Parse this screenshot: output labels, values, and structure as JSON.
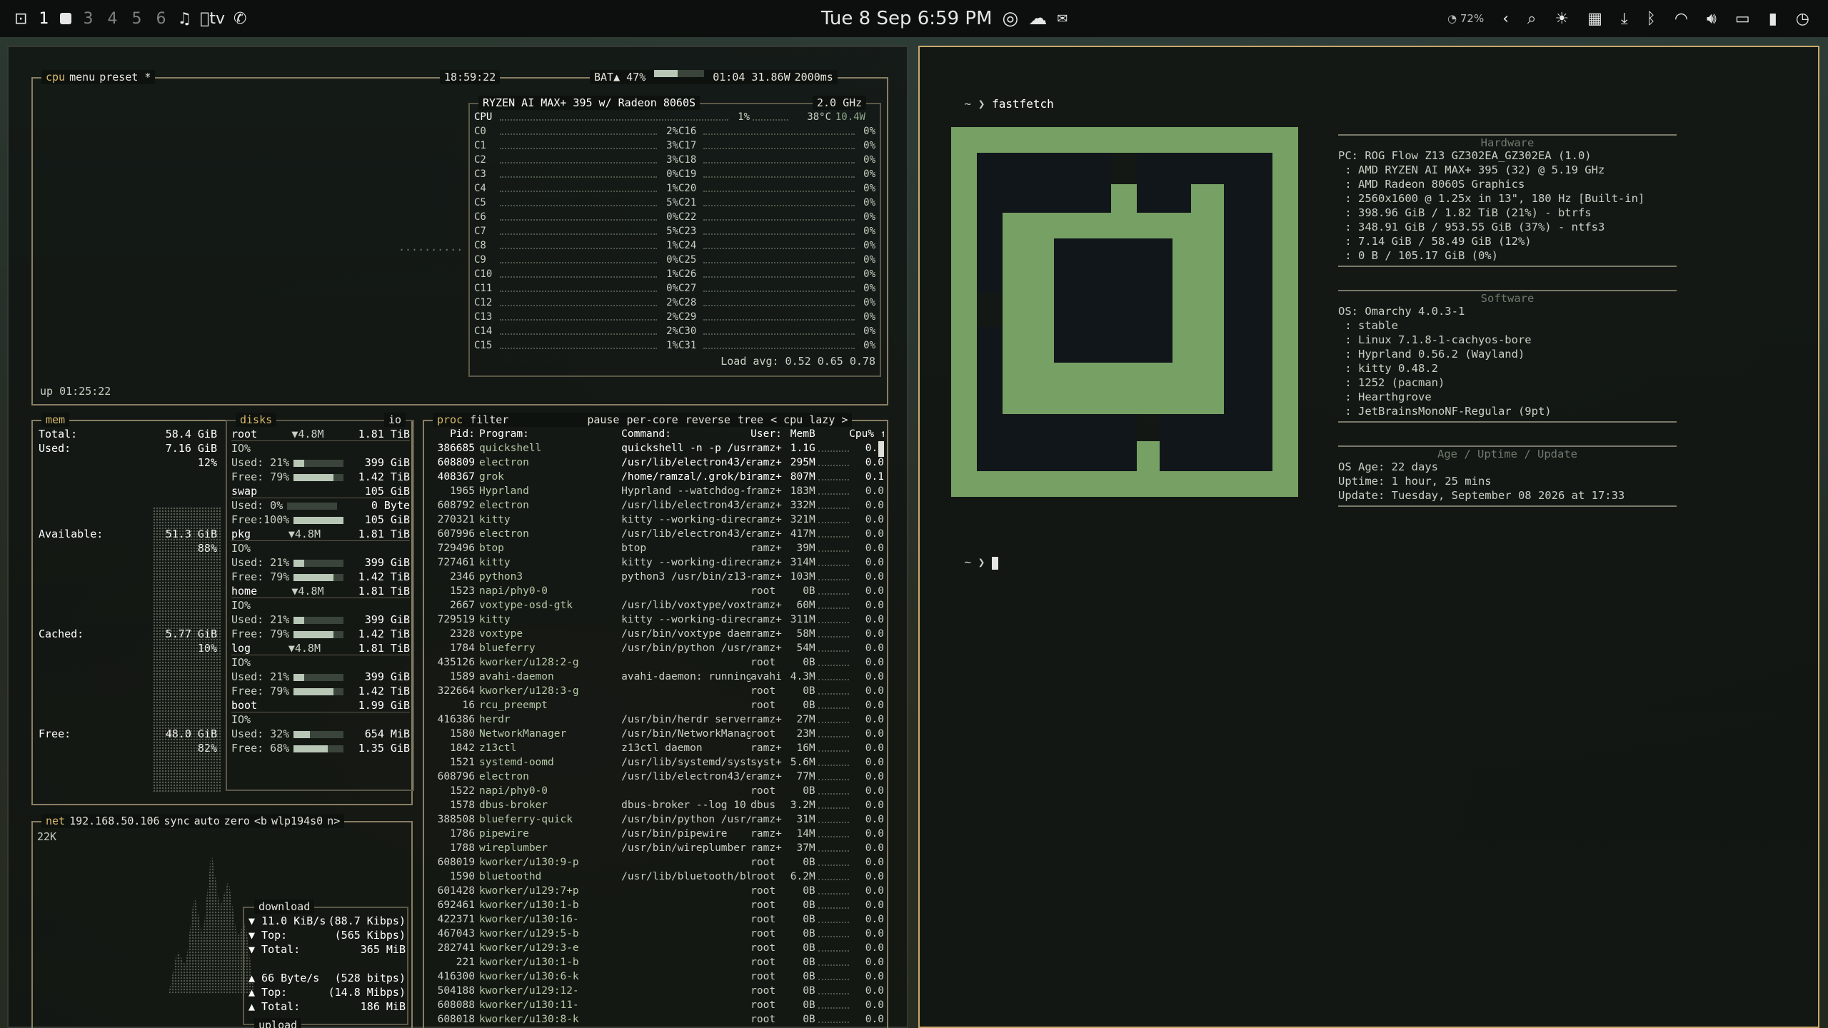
{
  "topbar": {
    "workspaces": [
      "1",
      "3",
      "4",
      "5",
      "6"
    ],
    "datetime": "Tue 8 Sep 6:59 PM",
    "battery_small": "72%",
    "apple_tv": "tv"
  },
  "btop": {
    "cpu_box": {
      "tabs": [
        "cpu",
        "menu",
        "preset *"
      ],
      "clock": "18:59:22",
      "battery": "BAT▲ 47%",
      "battery_level": 0.47,
      "power": "01:04 31.86W",
      "interval": "2000ms",
      "uptime": "up 01:25:22",
      "model": "RYZEN AI MAX+ 395 w/ Radeon 8060S",
      "freq": "2.0 GHz",
      "total": {
        "label": "CPU",
        "pct": "1%",
        "temp": "38°C",
        "watt": "10.4W"
      },
      "cores_left": [
        {
          "l": "C0",
          "p": "2%"
        },
        {
          "l": "C1",
          "p": "3%"
        },
        {
          "l": "C2",
          "p": "3%"
        },
        {
          "l": "C3",
          "p": "0%"
        },
        {
          "l": "C4",
          "p": "1%"
        },
        {
          "l": "C5",
          "p": "5%"
        },
        {
          "l": "C6",
          "p": "0%"
        },
        {
          "l": "C7",
          "p": "5%"
        },
        {
          "l": "C8",
          "p": "1%"
        },
        {
          "l": "C9",
          "p": "0%"
        },
        {
          "l": "C10",
          "p": "1%"
        },
        {
          "l": "C11",
          "p": "0%"
        },
        {
          "l": "C12",
          "p": "2%"
        },
        {
          "l": "C13",
          "p": "2%"
        },
        {
          "l": "C14",
          "p": "2%"
        },
        {
          "l": "C15",
          "p": "1%"
        }
      ],
      "cores_right": [
        {
          "l": "C16",
          "p": "0%"
        },
        {
          "l": "C17",
          "p": "0%"
        },
        {
          "l": "C18",
          "p": "0%"
        },
        {
          "l": "C19",
          "p": "0%"
        },
        {
          "l": "C20",
          "p": "0%"
        },
        {
          "l": "C21",
          "p": "0%"
        },
        {
          "l": "C22",
          "p": "0%"
        },
        {
          "l": "C23",
          "p": "0%"
        },
        {
          "l": "C24",
          "p": "0%"
        },
        {
          "l": "C25",
          "p": "0%"
        },
        {
          "l": "C26",
          "p": "0%"
        },
        {
          "l": "C27",
          "p": "0%"
        },
        {
          "l": "C28",
          "p": "0%"
        },
        {
          "l": "C29",
          "p": "0%"
        },
        {
          "l": "C30",
          "p": "0%"
        },
        {
          "l": "C31",
          "p": "0%"
        }
      ],
      "load_avg": "Load avg: 0.52 0.65 0.78"
    },
    "mem_box": {
      "title": "mem",
      "rows": [
        {
          "k": "Total:",
          "v": "58.4 GiB"
        },
        {
          "k": "Used:",
          "v": "7.16 GiB"
        },
        {
          "k": "",
          "v": "12%"
        },
        {
          "k": "Available:",
          "v": "51.3 GiB"
        },
        {
          "k": "",
          "v": "88%"
        },
        {
          "k": "Cached:",
          "v": "5.77 GiB"
        },
        {
          "k": "",
          "v": "10%"
        },
        {
          "k": "Free:",
          "v": "48.0 GiB"
        },
        {
          "k": "",
          "v": "82%"
        }
      ]
    },
    "disks_box": {
      "title": "disks",
      "io": "io",
      "disks": [
        {
          "name": "root",
          "io": "▼4.8M",
          "size": "1.81 TiB",
          "io_pct": "IO%",
          "used": "Used: 21%",
          "used_v": "399 GiB",
          "used_f": 0.21,
          "free": "Free: 79%",
          "free_v": "1.42 TiB",
          "free_f": 0.79
        },
        {
          "name": "swap",
          "io": "",
          "size": "105 GiB",
          "io_pct": "",
          "used": "Used:  0%",
          "used_v": "0 Byte",
          "used_f": 0,
          "free": "Free:100%",
          "free_v": "105 GiB",
          "free_f": 1.0
        },
        {
          "name": "pkg",
          "io": "▼4.8M",
          "size": "1.81 TiB",
          "io_pct": "IO%",
          "used": "Used: 21%",
          "used_v": "399 GiB",
          "used_f": 0.21,
          "free": "Free: 79%",
          "free_v": "1.42 TiB",
          "free_f": 0.79
        },
        {
          "name": "home",
          "io": "▼4.8M",
          "size": "1.81 TiB",
          "io_pct": "IO%",
          "used": "Used: 21%",
          "used_v": "399 GiB",
          "used_f": 0.21,
          "free": "Free: 79%",
          "free_v": "1.42 TiB",
          "free_f": 0.79
        },
        {
          "name": "log",
          "io": "▼4.8M",
          "size": "1.81 TiB",
          "io_pct": "IO%",
          "used": "Used: 21%",
          "used_v": "399 GiB",
          "used_f": 0.21,
          "free": "Free: 79%",
          "free_v": "1.42 TiB",
          "free_f": 0.79
        },
        {
          "name": "boot",
          "io": "",
          "size": "1.99 GiB",
          "io_pct": "IO%",
          "used": "Used: 32%",
          "used_v": "654 MiB",
          "used_f": 0.32,
          "free": "Free: 68%",
          "free_v": "1.35 GiB",
          "free_f": 0.68
        }
      ]
    },
    "net_box": {
      "tabs": [
        "net",
        "192.168.50.106",
        "sync",
        "auto",
        "zero",
        "<b",
        "wlp194s0",
        "n>"
      ],
      "scale": "22K",
      "download_title": "download",
      "download": [
        {
          "k": "▼ 11.0 KiB/s",
          "v": "(88.7 Kibps)"
        },
        {
          "k": "▼ Top:",
          "v": "(565 Kibps)"
        },
        {
          "k": "▼ Total:",
          "v": "365 MiB"
        }
      ],
      "upload": [
        {
          "k": "▲ 66 Byte/s",
          "v": "(528 bitps)"
        },
        {
          "k": "▲ Top:",
          "v": "(14.8 Mibps)"
        },
        {
          "k": "▲ Total:",
          "v": "186 MiB"
        }
      ],
      "upload_title": "upload"
    },
    "proc_box": {
      "tabs": [
        "proc",
        "filter",
        "pause",
        "per-core",
        "reverse",
        "tree",
        "< cpu lazy >"
      ],
      "headers": {
        "pid": "Pid:",
        "prog": "Program:",
        "cmd": "Command:",
        "user": "User:",
        "mem": "MemB",
        "cpu": "Cpu% ↑"
      },
      "rows": [
        {
          "pid": "386685",
          "prog": "quickshell",
          "cmd": "quickshell -n -p /usr",
          "user": "ramz+",
          "mem": "1.1G",
          "cpu": "0.1"
        },
        {
          "pid": "608809",
          "prog": "electron",
          "cmd": "/usr/lib/electron43/e",
          "user": "ramz+",
          "mem": "295M",
          "cpu": "0.0"
        },
        {
          "pid": "408367",
          "prog": "grok",
          "cmd": "/home/ramzal/.grok/bi",
          "user": "ramz+",
          "mem": "807M",
          "cpu": "0.1"
        },
        {
          "pid": "1965",
          "prog": "Hyprland",
          "cmd": "Hyprland --watchdog-f",
          "user": "ramz+",
          "mem": "183M",
          "cpu": "0.0"
        },
        {
          "pid": "608792",
          "prog": "electron",
          "cmd": "/usr/lib/electron43/e",
          "user": "ramz+",
          "mem": "332M",
          "cpu": "0.0"
        },
        {
          "pid": "270321",
          "prog": "kitty",
          "cmd": "kitty --working-direc",
          "user": "ramz+",
          "mem": "321M",
          "cpu": "0.0"
        },
        {
          "pid": "607996",
          "prog": "electron",
          "cmd": "/usr/lib/electron43/e",
          "user": "ramz+",
          "mem": "417M",
          "cpu": "0.0"
        },
        {
          "pid": "729496",
          "prog": "btop",
          "cmd": "btop",
          "user": "ramz+",
          "mem": "39M",
          "cpu": "0.0"
        },
        {
          "pid": "727461",
          "prog": "kitty",
          "cmd": "kitty --working-direc",
          "user": "ramz+",
          "mem": "314M",
          "cpu": "0.0"
        },
        {
          "pid": "2346",
          "prog": "python3",
          "cmd": "python3 /usr/bin/z13-",
          "user": "ramz+",
          "mem": "103M",
          "cpu": "0.0"
        },
        {
          "pid": "1523",
          "prog": "napi/phy0-0",
          "cmd": "",
          "user": "root",
          "mem": "0B",
          "cpu": "0.0"
        },
        {
          "pid": "2667",
          "prog": "voxtype-osd-gtk",
          "cmd": "/usr/lib/voxtype/voxt",
          "user": "ramz+",
          "mem": "60M",
          "cpu": "0.0"
        },
        {
          "pid": "729519",
          "prog": "kitty",
          "cmd": "kitty --working-direc",
          "user": "ramz+",
          "mem": "311M",
          "cpu": "0.0"
        },
        {
          "pid": "2328",
          "prog": "voxtype",
          "cmd": "/usr/bin/voxtype daem",
          "user": "ramz+",
          "mem": "58M",
          "cpu": "0.0"
        },
        {
          "pid": "1784",
          "prog": "blueferry",
          "cmd": "/usr/bin/python /usr/",
          "user": "ramz+",
          "mem": "54M",
          "cpu": "0.0"
        },
        {
          "pid": "435126",
          "prog": "kworker/u128:2-g",
          "cmd": "",
          "user": "root",
          "mem": "0B",
          "cpu": "0.0"
        },
        {
          "pid": "1589",
          "prog": "avahi-daemon",
          "cmd": "avahi-daemon: running",
          "user": "avahi",
          "mem": "4.3M",
          "cpu": "0.0"
        },
        {
          "pid": "322664",
          "prog": "kworker/u128:3-g",
          "cmd": "",
          "user": "root",
          "mem": "0B",
          "cpu": "0.0"
        },
        {
          "pid": "16",
          "prog": "rcu_preempt",
          "cmd": "",
          "user": "root",
          "mem": "0B",
          "cpu": "0.0"
        },
        {
          "pid": "416386",
          "prog": "herdr",
          "cmd": "/usr/bin/herdr server",
          "user": "ramz+",
          "mem": "27M",
          "cpu": "0.0"
        },
        {
          "pid": "1580",
          "prog": "NetworkManager",
          "cmd": "/usr/bin/NetworkManag",
          "user": "root",
          "mem": "23M",
          "cpu": "0.0"
        },
        {
          "pid": "1842",
          "prog": "z13ctl",
          "cmd": "z13ctl daemon",
          "user": "ramz+",
          "mem": "16M",
          "cpu": "0.0"
        },
        {
          "pid": "1521",
          "prog": "systemd-oomd",
          "cmd": "/usr/lib/systemd/syst",
          "user": "syst+",
          "mem": "5.6M",
          "cpu": "0.0"
        },
        {
          "pid": "608796",
          "prog": "electron",
          "cmd": "/usr/lib/electron43/e",
          "user": "ramz+",
          "mem": "77M",
          "cpu": "0.0"
        },
        {
          "pid": "1522",
          "prog": "napi/phy0-0",
          "cmd": "",
          "user": "root",
          "mem": "0B",
          "cpu": "0.0"
        },
        {
          "pid": "1578",
          "prog": "dbus-broker",
          "cmd": "dbus-broker --log 10",
          "user": "dbus",
          "mem": "3.2M",
          "cpu": "0.0"
        },
        {
          "pid": "388508",
          "prog": "blueferry-quick",
          "cmd": "/usr/bin/python /usr/",
          "user": "ramz+",
          "mem": "31M",
          "cpu": "0.0"
        },
        {
          "pid": "1786",
          "prog": "pipewire",
          "cmd": "/usr/bin/pipewire",
          "user": "ramz+",
          "mem": "14M",
          "cpu": "0.0"
        },
        {
          "pid": "1788",
          "prog": "wireplumber",
          "cmd": "/usr/bin/wireplumber",
          "user": "ramz+",
          "mem": "37M",
          "cpu": "0.0"
        },
        {
          "pid": "608019",
          "prog": "kworker/u130:9-p",
          "cmd": "",
          "user": "root",
          "mem": "0B",
          "cpu": "0.0"
        },
        {
          "pid": "1590",
          "prog": "bluetoothd",
          "cmd": "/usr/lib/bluetooth/bl",
          "user": "root",
          "mem": "6.2M",
          "cpu": "0.0"
        },
        {
          "pid": "601428",
          "prog": "kworker/u129:7+p",
          "cmd": "",
          "user": "root",
          "mem": "0B",
          "cpu": "0.0"
        },
        {
          "pid": "692461",
          "prog": "kworker/u130:1-b",
          "cmd": "",
          "user": "root",
          "mem": "0B",
          "cpu": "0.0"
        },
        {
          "pid": "422371",
          "prog": "kworker/u130:16-",
          "cmd": "",
          "user": "root",
          "mem": "0B",
          "cpu": "0.0"
        },
        {
          "pid": "467043",
          "prog": "kworker/u129:5-b",
          "cmd": "",
          "user": "root",
          "mem": "0B",
          "cpu": "0.0"
        },
        {
          "pid": "282741",
          "prog": "kworker/u129:3-e",
          "cmd": "",
          "user": "root",
          "mem": "0B",
          "cpu": "0.0"
        },
        {
          "pid": "221",
          "prog": "kworker/u130:1-b",
          "cmd": "",
          "user": "root",
          "mem": "0B",
          "cpu": "0.0"
        },
        {
          "pid": "416300",
          "prog": "kworker/u130:6-k",
          "cmd": "",
          "user": "root",
          "mem": "0B",
          "cpu": "0.0"
        },
        {
          "pid": "504188",
          "prog": "kworker/u129:12-",
          "cmd": "",
          "user": "root",
          "mem": "0B",
          "cpu": "0.0"
        },
        {
          "pid": "608088",
          "prog": "kworker/u130:11-",
          "cmd": "",
          "user": "root",
          "mem": "0B",
          "cpu": "0.0"
        },
        {
          "pid": "608018",
          "prog": "kworker/u130:8-k",
          "cmd": "",
          "user": "root",
          "mem": "0B",
          "cpu": "0.0"
        }
      ]
    }
  },
  "terminal": {
    "prompt": "~ ❯",
    "command": "fastfetch",
    "prompt2": "~ ❯",
    "hardware_title": "Hardware",
    "hardware": [
      "PC: ROG Flow Z13 GZ302EA_GZ302EA (1.0)",
      " : AMD RYZEN AI MAX+ 395 (32) @ 5.19 GHz",
      " : AMD Radeon 8060S Graphics",
      " : 2560x1600 @ 1.25x in 13\", 180 Hz [Built-in]",
      " : 398.96 GiB / 1.82 TiB (21%) - btrfs",
      " : 348.91 GiB / 953.55 GiB (37%) - ntfs3",
      " : 7.14 GiB / 58.49 GiB (12%)",
      " : 0 B / 105.17 GiB (0%)"
    ],
    "software_title": "Software",
    "software": [
      "OS: Omarchy 4.0.3-1",
      " : stable",
      " : Linux 7.1.8-1-cachyos-bore",
      " : Hyprland 0.56.2 (Wayland)",
      " : kitty 0.48.2",
      " : 1252 (pacman)",
      " : Hearthgrove",
      " : JetBrainsMonoNF-Regular (9pt)"
    ],
    "age_title": "Age / Uptime / Update",
    "age": [
      "OS Age: 22 days",
      "Uptime: 1 hour, 25 mins",
      "Update: Tuesday, September 08 2026 at 17:33"
    ]
  },
  "colors": {
    "accent": "#d8b86a",
    "logo": "#77a065",
    "border": "#8a7e63"
  }
}
